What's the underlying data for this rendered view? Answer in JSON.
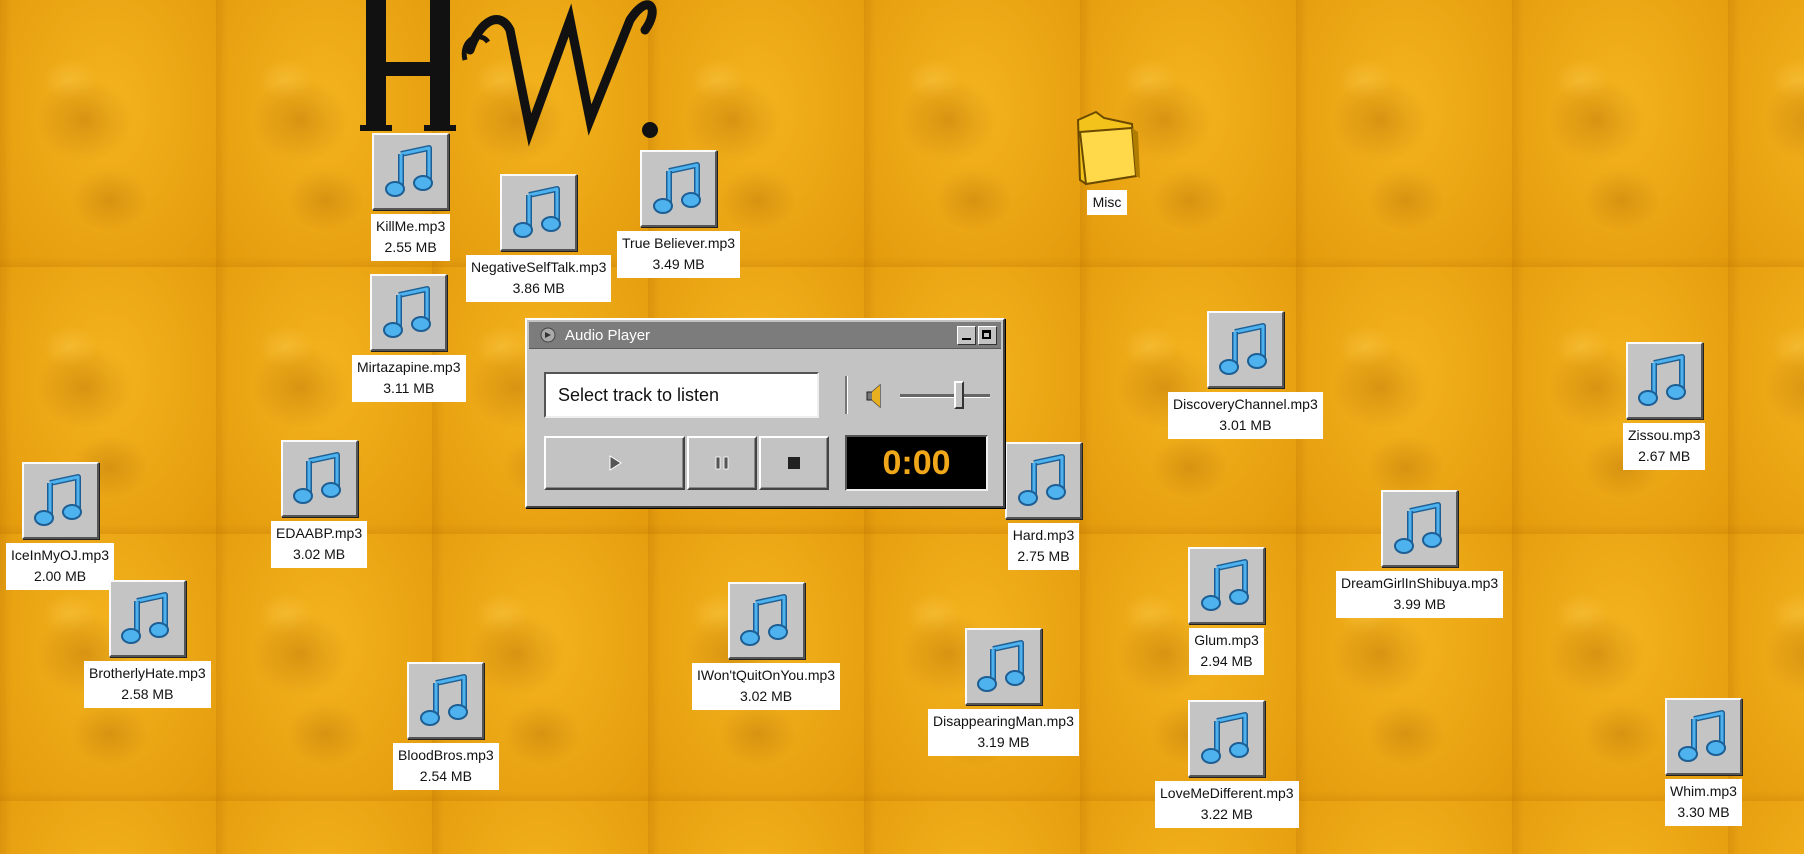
{
  "colors": {
    "desktop": "#e9a10f",
    "window_face": "#c3c3c3",
    "titlebar": "#7c7c7c",
    "time_text": "#f0a81a",
    "icon_note": "#3aa0e0"
  },
  "folder": {
    "name": "Misc",
    "icon": "folder-icon"
  },
  "tracks": [
    {
      "name": "KillMe.mp3",
      "size": "2.55 MB"
    },
    {
      "name": "NegativeSelfTalk.mp3",
      "size": "3.86 MB"
    },
    {
      "name": "True Believer.mp3",
      "size": "3.49 MB"
    },
    {
      "name": "Mirtazapine.mp3",
      "size": "3.11 MB"
    },
    {
      "name": "EDAABP.mp3",
      "size": "3.02 MB"
    },
    {
      "name": "IceInMyOJ.mp3",
      "size": "2.00 MB"
    },
    {
      "name": "BrotherlyHate.mp3",
      "size": "2.58 MB"
    },
    {
      "name": "BloodBros.mp3",
      "size": "2.54 MB"
    },
    {
      "name": "IWon'tQuitOnYou.mp3",
      "size": "3.02 MB"
    },
    {
      "name": "DisappearingMan.mp3",
      "size": "3.19 MB"
    },
    {
      "name": "Hard.mp3",
      "size": "2.75 MB"
    },
    {
      "name": "DiscoveryChannel.mp3",
      "size": "3.01 MB"
    },
    {
      "name": "Glum.mp3",
      "size": "2.94 MB"
    },
    {
      "name": "LoveMeDifferent.mp3",
      "size": "3.22 MB"
    },
    {
      "name": "DreamGirlInShibuya.mp3",
      "size": "3.99 MB"
    },
    {
      "name": "Zissou.mp3",
      "size": "2.67 MB"
    },
    {
      "name": "Whim.mp3",
      "size": "3.30 MB"
    }
  ],
  "player": {
    "title": "Audio Player",
    "track_display": "Select track to listen",
    "time": "0:00",
    "volume": 0.65,
    "icons": {
      "play": "play-icon",
      "pause": "pause-icon",
      "stop": "stop-icon",
      "speaker": "speaker-icon"
    }
  }
}
